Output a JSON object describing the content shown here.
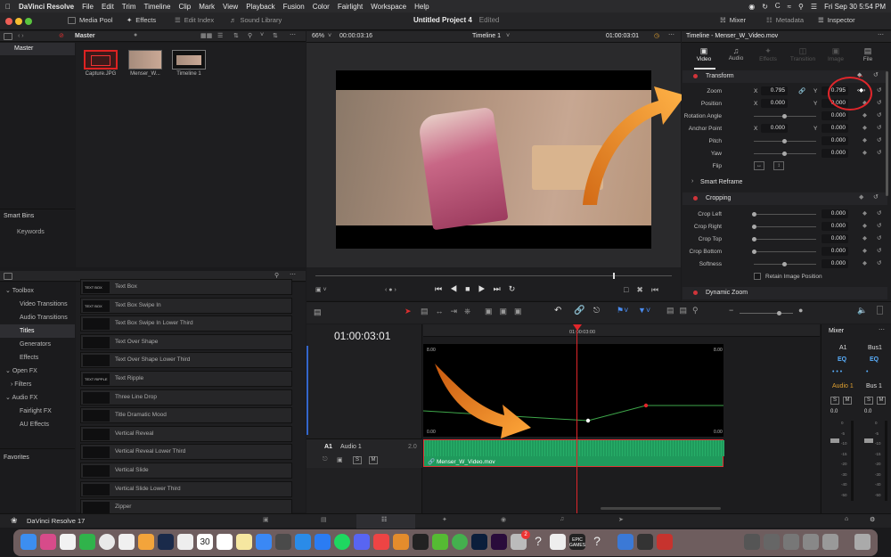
{
  "menubar": {
    "app": "DaVinci Resolve",
    "items": [
      "File",
      "Edit",
      "Trim",
      "Timeline",
      "Clip",
      "Mark",
      "View",
      "Playback",
      "Fusion",
      "Color",
      "Fairlight",
      "Workspace",
      "Help"
    ],
    "clock": "Fri Sep 30  5:54 PM"
  },
  "toolbar": {
    "media_pool": "Media Pool",
    "effects": "Effects",
    "edit_index": "Edit Index",
    "sound_library": "Sound Library",
    "project_title": "Untitled Project 4",
    "project_status": "Edited",
    "mixer": "Mixer",
    "metadata": "Metadata",
    "inspector": "Inspector"
  },
  "media_pool": {
    "bin": "Master",
    "sidebar_master": "Master",
    "smart_bins": "Smart Bins",
    "keywords": "Keywords",
    "clips": [
      {
        "name": "Capture.JPG"
      },
      {
        "name": "Menser_W..."
      },
      {
        "name": "Timeline 1"
      }
    ]
  },
  "viewer": {
    "zoom": "66%",
    "source_tc": "00:00:03:16",
    "timeline_name": "Timeline 1",
    "record_tc": "01:00:03:01"
  },
  "effects": {
    "toolbox": "Toolbox",
    "nav": [
      {
        "label": "Video Transitions"
      },
      {
        "label": "Audio Transitions"
      },
      {
        "label": "Titles"
      },
      {
        "label": "Generators"
      },
      {
        "label": "Effects"
      }
    ],
    "open_fx": "Open FX",
    "filters": "Filters",
    "audio_fx": "Audio FX",
    "audio_sub": [
      {
        "label": "Fairlight FX"
      },
      {
        "label": "AU Effects"
      }
    ],
    "favorites": "Favorites",
    "titles": [
      {
        "label": "Text Box",
        "preview": "TEXT BOX"
      },
      {
        "label": "Text Box Swipe In",
        "preview": "TEXT BOX"
      },
      {
        "label": "Text Box Swipe In Lower Third",
        "preview": ""
      },
      {
        "label": "Text Over Shape",
        "preview": ""
      },
      {
        "label": "Text Over Shape Lower Third",
        "preview": ""
      },
      {
        "label": "Text Ripple",
        "preview": "TEXT RIPPLE"
      },
      {
        "label": "Three Line Drop",
        "preview": ""
      },
      {
        "label": "Title Dramatic Mood",
        "preview": ""
      },
      {
        "label": "Vertical Reveal",
        "preview": ""
      },
      {
        "label": "Vertical Reveal Lower Third",
        "preview": ""
      },
      {
        "label": "Vertical Slide",
        "preview": ""
      },
      {
        "label": "Vertical Slide Lower Third",
        "preview": ""
      },
      {
        "label": "Zipper",
        "preview": ""
      }
    ]
  },
  "inspector": {
    "title": "Timeline - Menser_W_Video.mov",
    "tabs": [
      "Video",
      "Audio",
      "Effects",
      "Transition",
      "Image",
      "File"
    ],
    "transform": "Transform",
    "zoom_label": "Zoom",
    "zoom_x": "0.795",
    "zoom_y": "0.795",
    "position_label": "Position",
    "pos_x": "0.000",
    "pos_y": "0.000",
    "rotation_label": "Rotation Angle",
    "rotation": "0.000",
    "anchor_label": "Anchor Point",
    "anchor_x": "0.000",
    "anchor_y": "0.000",
    "pitch_label": "Pitch",
    "pitch": "0.000",
    "yaw_label": "Yaw",
    "yaw": "0.000",
    "flip_label": "Flip",
    "x_axis": "X",
    "y_axis": "Y",
    "smart_reframe": "Smart Reframe",
    "cropping": "Cropping",
    "crop_left_label": "Crop Left",
    "crop_left": "0.000",
    "crop_right_label": "Crop Right",
    "crop_right": "0.000",
    "crop_top_label": "Crop Top",
    "crop_top": "0.000",
    "crop_bottom_label": "Crop Bottom",
    "crop_bottom": "0.000",
    "softness_label": "Softness",
    "softness": "0.000",
    "retain_label": "Retain Image Position",
    "dynamic_zoom": "Dynamic Zoom"
  },
  "timeline": {
    "timecode": "01:00:03:01",
    "ruler_tc": "01:00:03:00",
    "curve_top_left": "8.00",
    "curve_top_right": "8.00",
    "curve_bottom_left": "0.00",
    "curve_bottom_right": "0.00",
    "track_id": "A1",
    "track_name": "Audio 1",
    "track_level": "2.0",
    "track_s": "S",
    "track_m": "M",
    "clip_name": "Menser_W_Video.mov"
  },
  "mixer": {
    "title": "Mixer",
    "ch1": "A1",
    "ch2": "Bus1",
    "eq": "EQ",
    "ch1_name": "Audio 1",
    "ch2_name": "Bus 1",
    "s": "S",
    "m": "M",
    "level": "0.0",
    "scale": [
      "0",
      "-5",
      "-10",
      "-15",
      "-20",
      "-30",
      "-40",
      "-50"
    ]
  },
  "footer": {
    "app_name": "DaVinci Resolve 17"
  },
  "dock": {
    "calendar_day": "30",
    "epic_label": "EPIC GAMES",
    "badge": "2"
  },
  "colors": {
    "accent_red": "#e0262b",
    "clip_green": "#1f9a5c",
    "arrow_orange": "#f08c1a"
  }
}
